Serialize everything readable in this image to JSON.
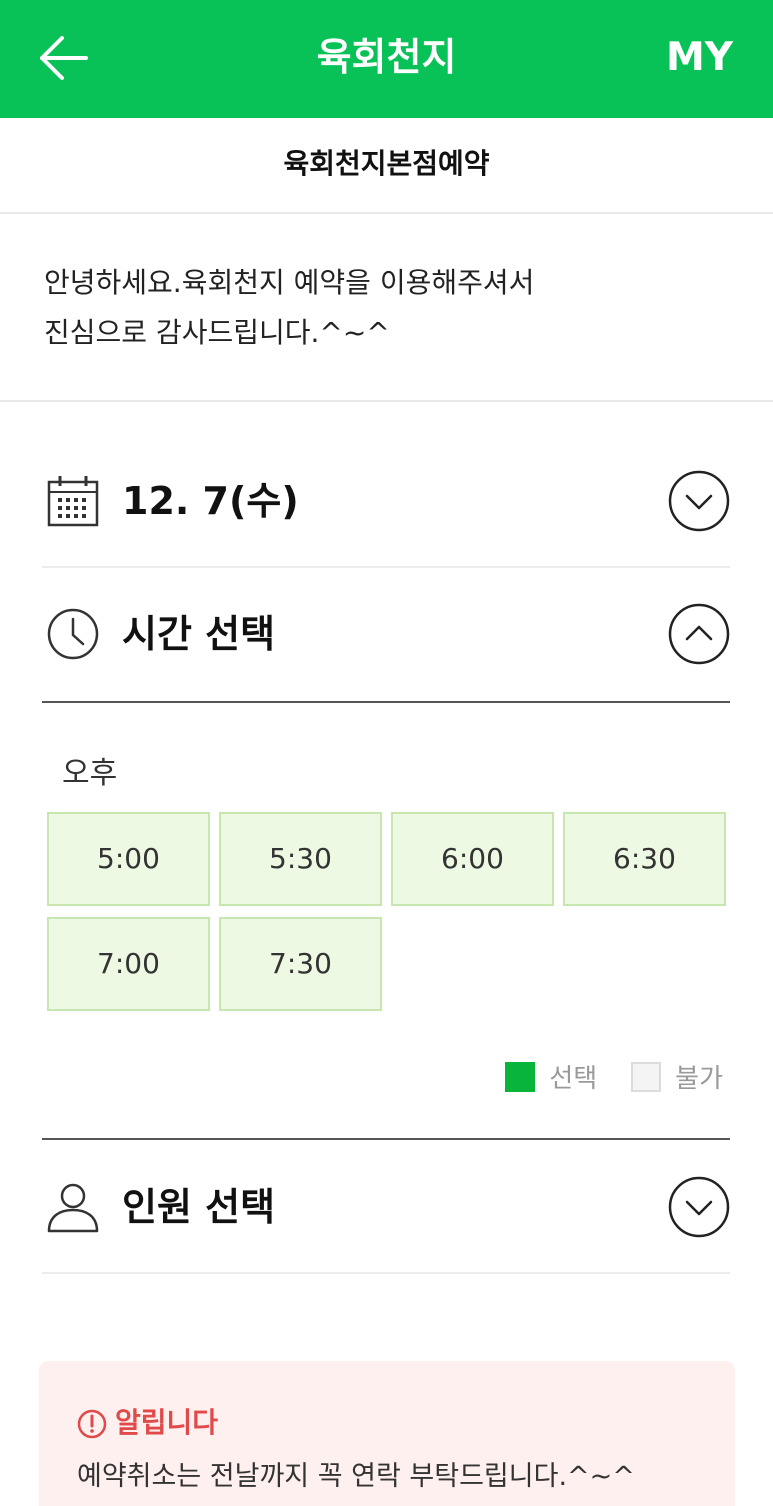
{
  "header": {
    "title": "육회천지",
    "my_label": "MY",
    "back_icon": "arrow-left-icon",
    "bg_color": "#08c157"
  },
  "subheader": {
    "title": "육회천지본점예약"
  },
  "greeting": {
    "line1": "안녕하세요.육회천지 예약을 이용해주셔서",
    "line2": "진심으로 감사드립니다.^~^"
  },
  "date_section": {
    "label": "12. 7(수)",
    "icon": "calendar-icon",
    "expanded": false
  },
  "time_section": {
    "label": "시간 선택",
    "icon": "clock-icon",
    "expanded": true,
    "period": "오후",
    "slots": [
      "5:00",
      "5:30",
      "6:00",
      "6:30",
      "7:00",
      "7:30"
    ],
    "legend": {
      "selected": "선택",
      "unavailable": "불가"
    },
    "slot_bg_color": "#eef9e3",
    "selected_color": "#08b43a"
  },
  "people_section": {
    "label": "인원 선택",
    "icon": "person-icon",
    "expanded": false
  },
  "notice": {
    "title": "알립니다",
    "body": "예약취소는 전날까지 꼭 연락 부탁드립니다.^~^",
    "accent_color": "#e04a4a",
    "bg_color": "#fdf0ef"
  }
}
